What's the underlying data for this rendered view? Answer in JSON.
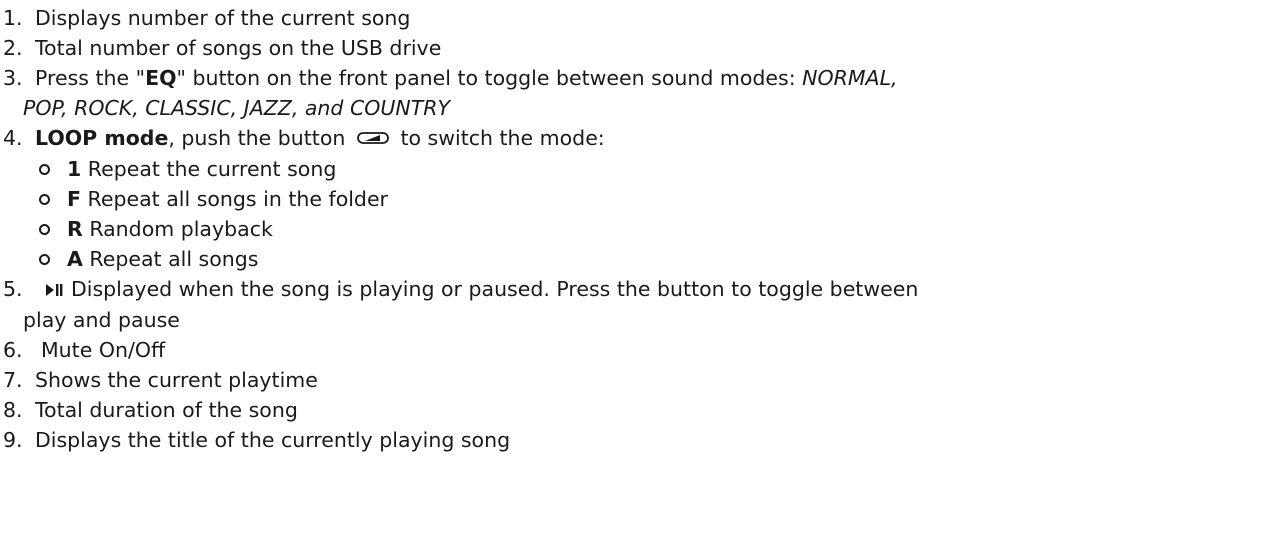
{
  "items": [
    {
      "num": "1.",
      "text": "Displays number of the current song"
    },
    {
      "num": "2.",
      "text": "Total number of songs on the USB drive"
    },
    {
      "num": "3.",
      "pre": "Press the \"",
      "bold": "EQ",
      "mid": "\" button on the front panel to toggle between sound modes: ",
      "italic_line1": "NORMAL,",
      "italic_line2": "POP, ROCK, CLASSIC, JAZZ, and COUNTRY"
    },
    {
      "num": "4.",
      "bold": "LOOP mode",
      "pre": ", push the button",
      "post": "to switch the mode:",
      "sub": [
        {
          "key": "1",
          "text": "Repeat the current song"
        },
        {
          "key": "F",
          "text": "Repeat all songs in the folder"
        },
        {
          "key": "R",
          "text": "Random playback"
        },
        {
          "key": "A",
          "text": "Repeat all songs"
        }
      ]
    },
    {
      "num": "5.",
      "line1": "Displayed when the song is playing or paused. Press the button to toggle between",
      "line2": "play and pause"
    },
    {
      "num": "6.",
      "text": "Mute On/Off"
    },
    {
      "num": "7.",
      "text": "Shows the current playtime"
    },
    {
      "num": "8.",
      "text": "Total duration of the song"
    },
    {
      "num": "9.",
      "text": "Displays the title of the currently playing song"
    }
  ],
  "icons": {
    "loop": "loop-mode-icon",
    "play_pause": "play-pause-icon"
  }
}
